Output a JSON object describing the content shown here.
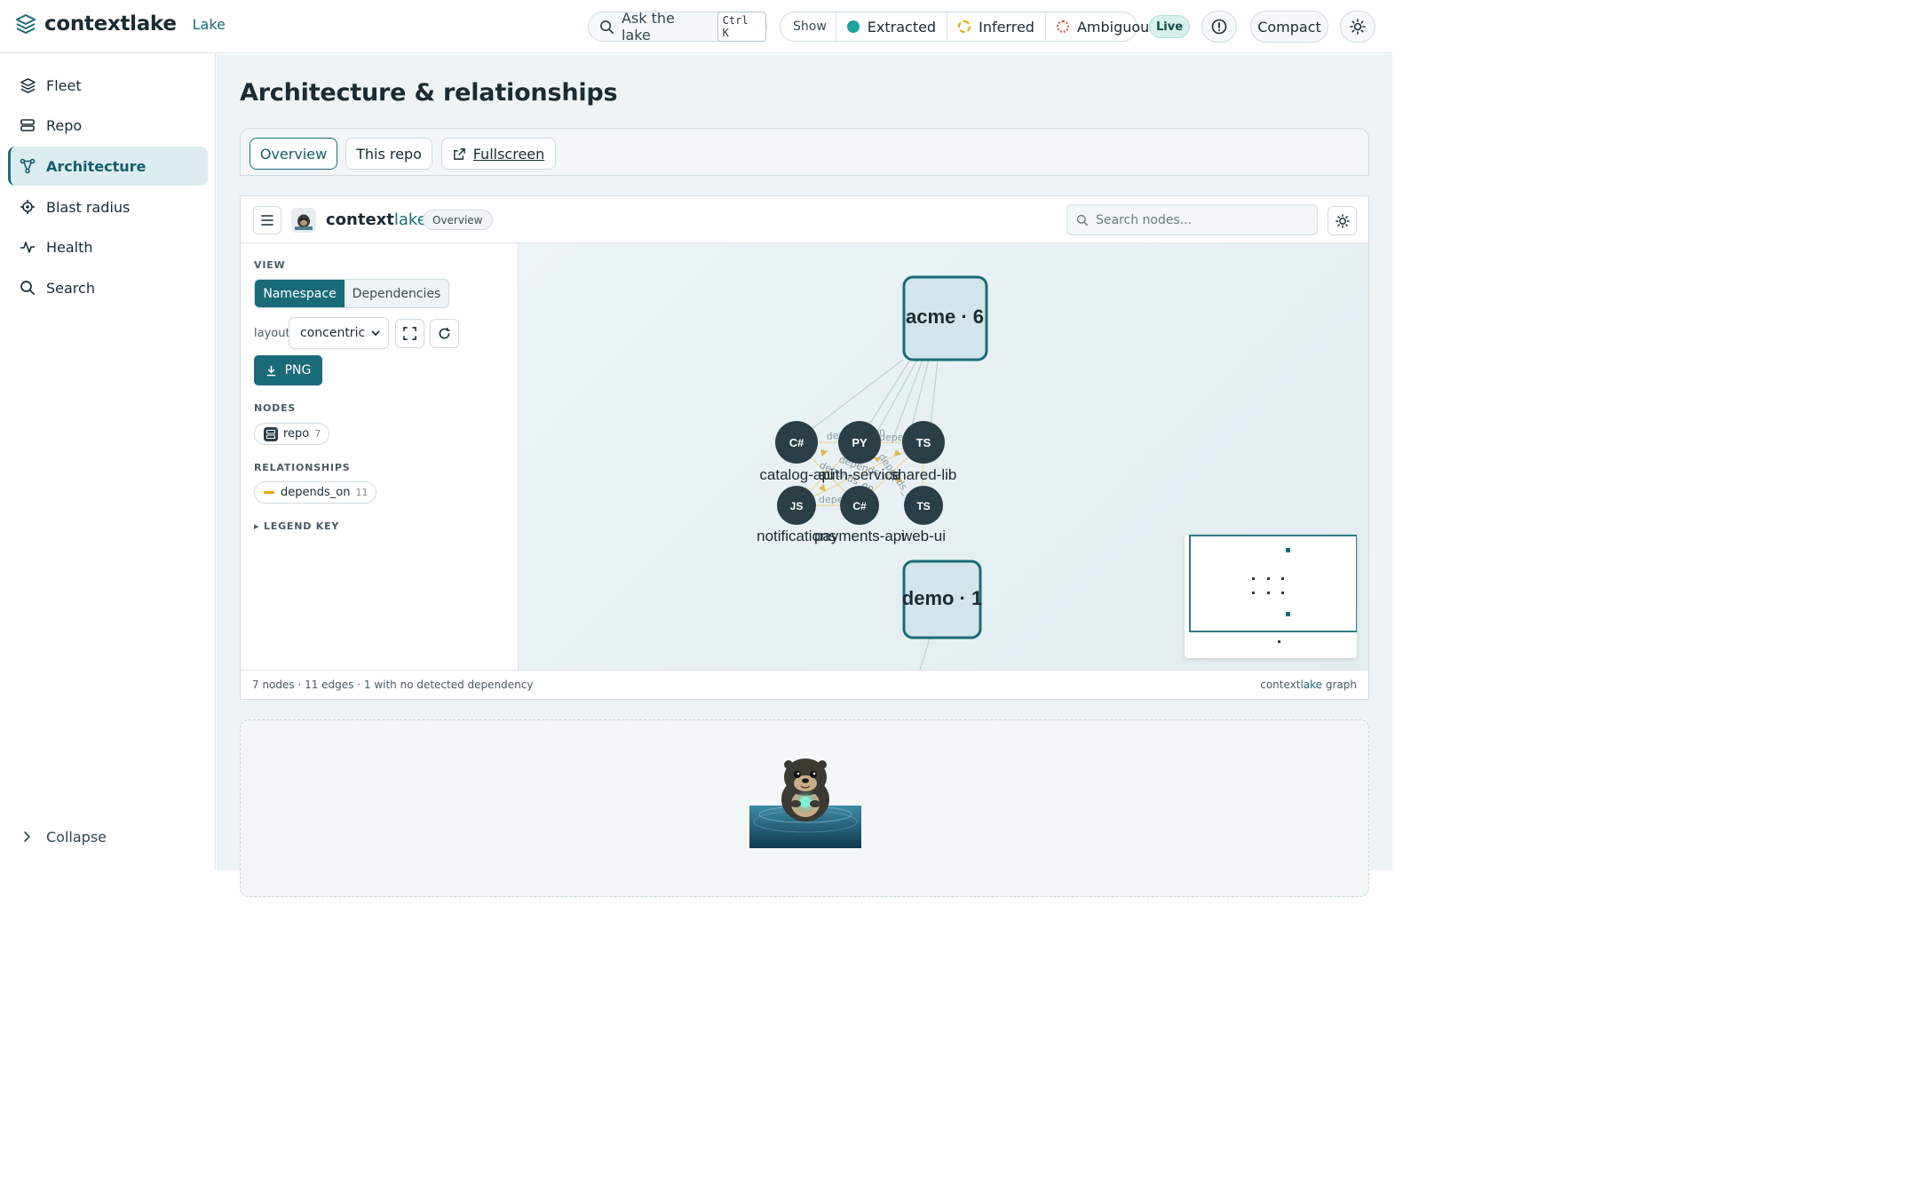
{
  "app": {
    "name": "contextlake",
    "section": "Lake"
  },
  "topbar": {
    "search_label": "Ask the lake",
    "search_shortcut": "Ctrl K",
    "show_label": "Show",
    "filters": [
      {
        "label": "Extracted",
        "style": "solid",
        "color": "#1ba39c"
      },
      {
        "label": "Inferred",
        "style": "dashed",
        "color": "#e0a800"
      },
      {
        "label": "Ambiguous",
        "style": "dotted",
        "color": "#d8553a"
      }
    ],
    "live_label": "Live",
    "compact_label": "Compact"
  },
  "sidebar": {
    "items": [
      {
        "label": "Fleet",
        "icon": "layers-icon"
      },
      {
        "label": "Repo",
        "icon": "server-icon"
      },
      {
        "label": "Architecture",
        "icon": "graph-icon",
        "active": true
      },
      {
        "label": "Blast radius",
        "icon": "target-icon"
      },
      {
        "label": "Health",
        "icon": "pulse-icon"
      },
      {
        "label": "Search",
        "icon": "search-icon"
      }
    ],
    "collapse_label": "Collapse"
  },
  "main": {
    "title": "Architecture & relationships",
    "tabs": [
      {
        "label": "Overview",
        "active": true
      },
      {
        "label": "This repo"
      },
      {
        "label": "Fullscreen",
        "icon": "external-link-icon"
      }
    ]
  },
  "graph": {
    "brand_a": "context",
    "brand_b": "lake",
    "badge": "Overview",
    "search_placeholder": "Search nodes...",
    "view_label": "VIEW",
    "view_options": [
      "Namespace",
      "Dependencies"
    ],
    "layout_label": "layout",
    "layout_value": "concentric",
    "png_label": "PNG",
    "nodes_label": "NODES",
    "node_chip": {
      "label": "repo",
      "count": "7"
    },
    "relationships_label": "RELATIONSHIPS",
    "rel_chip": {
      "label": "depends_on",
      "count": "11",
      "color": "#e0a800"
    },
    "legend_key_label": "▸ LEGEND KEY",
    "groups": [
      {
        "label": "acme · 6"
      },
      {
        "label": "demo · 1"
      }
    ],
    "repos": [
      {
        "lang": "C#",
        "name": "catalog-api"
      },
      {
        "lang": "PY",
        "name": "auth-service"
      },
      {
        "lang": "TS",
        "name": "shared-lib"
      },
      {
        "lang": "JS",
        "name": "notifications"
      },
      {
        "lang": "C#",
        "name": "payments-api"
      },
      {
        "lang": "TS",
        "name": "web-ui"
      }
    ],
    "edge_labels": [
      "depends_on",
      "depends_on",
      "depends_on",
      "depends_on",
      "depends_on",
      "depends_on"
    ],
    "footer_left": "7 nodes · 11 edges · 1 with no detected dependency",
    "footer_right_a": "context",
    "footer_right_b": "lake",
    "footer_right_c": " graph"
  }
}
